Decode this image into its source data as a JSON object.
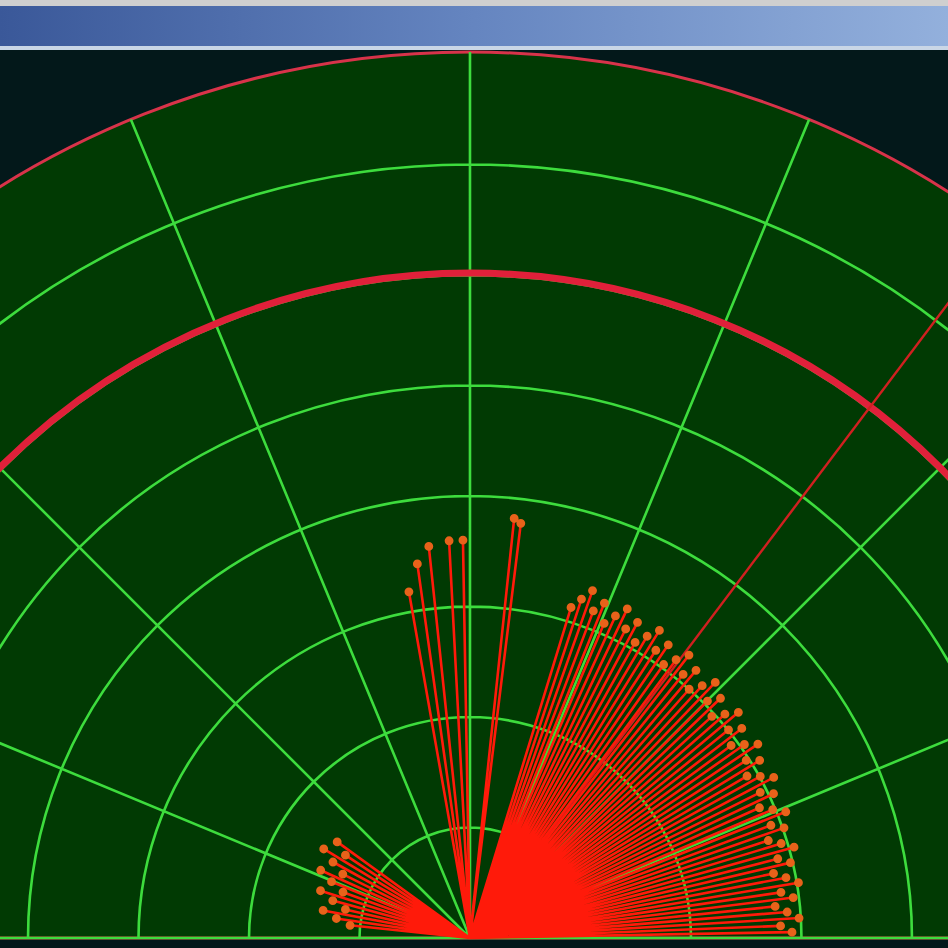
{
  "radar_display": {
    "kind": "polar_scan"
  }
}
